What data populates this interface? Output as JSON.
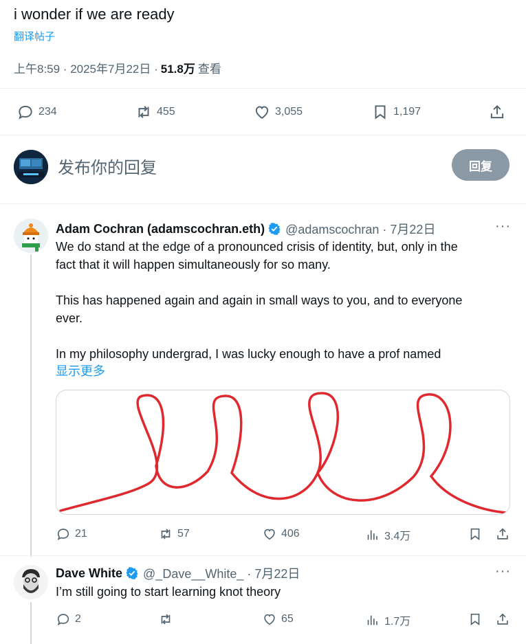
{
  "main_tweet": {
    "text": "i wonder if we are ready",
    "translate_label": "翻译帖子",
    "time": "上午8:59 · 2025年7月22日 · ",
    "views_count": "51.8万",
    "views_label": "查看",
    "replies": "234",
    "reposts": "455",
    "likes": "3,055",
    "bookmarks": "1,197"
  },
  "reply_box": {
    "placeholder": "发布你的回复",
    "button_label": "回复"
  },
  "replies": [
    {
      "name": "Adam Cochran (adamscochran.eth)",
      "handle": "@adamscochran · 7月22日",
      "text_lines": [
        "We do stand at the edge of a pronounced crisis of identity, but, only in the",
        "fact that it will happen simultaneously for so many.",
        "This has happened again and again in small ways to you, and to everyone",
        "ever.",
        "In my philosophy undergrad, I was lucky enough to have a prof named"
      ],
      "show_more": "显示更多",
      "replies": "21",
      "reposts": "57",
      "likes": "406",
      "views": "3.4万"
    },
    {
      "name": "Dave White",
      "handle": "@_Dave__White_ · 7月22日",
      "text": "I’m still going to start learning knot theory",
      "replies": "2",
      "reposts": "",
      "likes": "65",
      "views": "1.7万"
    }
  ],
  "colors": {
    "accent": "#1d9bf0",
    "secondary_text": "#536471",
    "verified": "#1d9bf0",
    "knot_red": "#e0282f"
  }
}
